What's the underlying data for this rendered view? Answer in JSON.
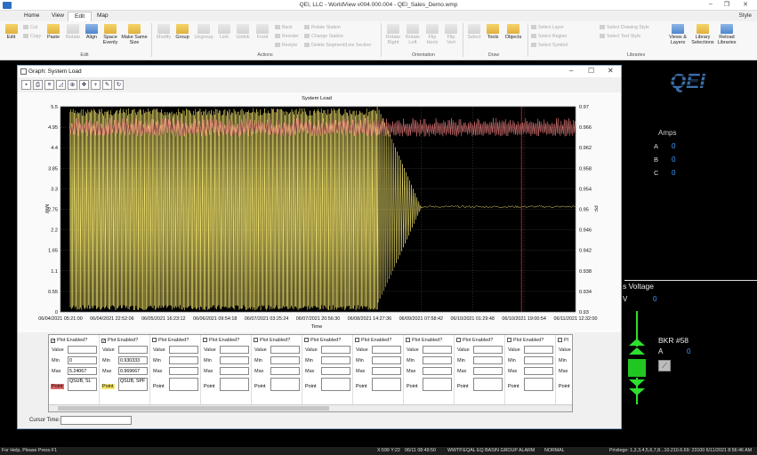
{
  "window": {
    "title": "QEI, LLC - WorldView v004.000.004 - QEI_Sales_Demo.wmp"
  },
  "menu": {
    "tabs": [
      "Home",
      "View",
      "Edit",
      "Map"
    ],
    "active": "Edit",
    "style_label": "Style"
  },
  "ribbon": {
    "edit_label": "Edit",
    "cut": "Cut",
    "copy": "Copy",
    "paste": "Paste",
    "rotate": "Rotate",
    "align": "Align",
    "space_evenly": "Space Evenly",
    "make_same_size": "Make Same Size",
    "modify": "Modify",
    "group": "Group",
    "ungroup": "Ungroup",
    "link": "Link",
    "unlink": "Unlink",
    "front": "Front",
    "back": "Back",
    "reorder": "Reorder",
    "restyle": "Restyle",
    "rotate_station": "Rotate Station",
    "change_station": "Change Station",
    "delete_segment": "Delete Segment/Line Section",
    "rotate_right": "Rotate Right",
    "rotate_left": "Rotate Left",
    "flip_horiz": "Flip Horiz",
    "flip_vert": "Flip Vert",
    "select": "Select",
    "tools": "Tools",
    "objects": "Objects",
    "select_layer": "Select Layer",
    "select_region": "Select Region",
    "select_symbol": "Select Symbol",
    "select_drawing_style": "Select Drawing Style",
    "select_text_style": "Select Text Style",
    "views_layers": "Views & Layers",
    "library_selections": "Library Selections",
    "reload_libraries": "Reload Libraries",
    "groups": {
      "edit": "Edit",
      "actions": "Actions",
      "orientation": "Orientation",
      "draw": "Draw",
      "libraries": "Libraries"
    }
  },
  "canvas": {
    "logo": "QEI",
    "amps_label": "Amps",
    "phases": [
      {
        "name": "A",
        "value": "0"
      },
      {
        "name": "B",
        "value": "0"
      },
      {
        "name": "C",
        "value": "0"
      }
    ],
    "bus_voltage_label": "s Voltage",
    "bus_v_unit": "V",
    "bus_v_value": "0",
    "breaker_label": "BKR  #58",
    "breaker_a_label": "A",
    "breaker_a_value": "0"
  },
  "graph_window": {
    "title": "Graph: System Load",
    "legend": [
      {
        "enabled": true,
        "label": "Plot Enabled?",
        "value": "",
        "min": "0",
        "max": "5.24067",
        "name": "QSUB, SL",
        "point": "Point",
        "color": "#e06666"
      },
      {
        "enabled": true,
        "label": "Plot Enabled?",
        "value": "",
        "min": "0.930333",
        "max": "0.969667",
        "name": "QSUB, SPF",
        "point": "Point",
        "color": "#f5e66e"
      },
      {
        "enabled": false,
        "label": "Plot Enabled?",
        "value": "",
        "min": "",
        "max": "",
        "name": "",
        "point": "Point",
        "color": ""
      },
      {
        "enabled": false,
        "label": "Plot Enabled?",
        "value": "",
        "min": "",
        "max": "",
        "name": "",
        "point": "Point",
        "color": ""
      },
      {
        "enabled": false,
        "label": "Plot Enabled?",
        "value": "",
        "min": "",
        "max": "",
        "name": "",
        "point": "Point",
        "color": ""
      },
      {
        "enabled": false,
        "label": "Plot Enabled?",
        "value": "",
        "min": "",
        "max": "",
        "name": "",
        "point": "Point",
        "color": ""
      },
      {
        "enabled": false,
        "label": "Plot Enabled?",
        "value": "",
        "min": "",
        "max": "",
        "name": "",
        "point": "Point",
        "color": ""
      },
      {
        "enabled": false,
        "label": "Plot Enabled?",
        "value": "",
        "min": "",
        "max": "",
        "name": "",
        "point": "Point",
        "color": ""
      },
      {
        "enabled": false,
        "label": "Plot Enabled?",
        "value": "",
        "min": "",
        "max": "",
        "name": "",
        "point": "Point",
        "color": ""
      },
      {
        "enabled": false,
        "label": "Plot Enabled?",
        "value": "",
        "min": "",
        "max": "",
        "name": "",
        "point": "Point",
        "color": ""
      },
      {
        "enabled": false,
        "label": "Pl",
        "value": "",
        "min": "",
        "max": "",
        "name": "",
        "point": "Point",
        "color": ""
      }
    ],
    "row_labels": {
      "value": "Value",
      "min": "Min",
      "max": "Max"
    },
    "cursor_time_label": "Cursor Time:",
    "cursor_time_value": ""
  },
  "chart_data": {
    "type": "line",
    "title": "System Load",
    "xlabel": "Time",
    "ylabel": "MW",
    "y2label": "PF",
    "x_ticks": [
      "06/04/2021 05:21:00",
      "06/04/2021 22:52:06",
      "06/05/2021 16:23:12",
      "06/06/2021 09:54:18",
      "06/07/2021 03:25:24",
      "06/07/2021 20:56:30",
      "06/08/2021 14:27:36",
      "06/09/2021 07:58:42",
      "06/10/2021 01:29:48",
      "06/10/2021 19:00:54",
      "06/11/2021 12:32:00"
    ],
    "ylim": [
      0,
      5.5
    ],
    "y_ticks": [
      "0",
      "0.55",
      "1.1",
      "1.65",
      "2.2",
      "2.75",
      "3.3",
      "3.85",
      "4.4",
      "4.95",
      "5.5"
    ],
    "y2lim": [
      0.93,
      0.97
    ],
    "y2_ticks": [
      "0.93",
      "0.934",
      "0.938",
      "0.942",
      "0.946",
      "0.95",
      "0.954",
      "0.958",
      "0.962",
      "0.966",
      "0.97"
    ],
    "grid": true,
    "series": [
      {
        "name": "QSUB, SL",
        "color": "#f08080",
        "axis": "left",
        "min": 0,
        "max": 5.24067
      },
      {
        "name": "QSUB, SPF",
        "color": "#f5e66e",
        "axis": "right",
        "min": 0.930333,
        "max": 0.969667
      }
    ],
    "cursor_at_tick_index": 8.95
  },
  "statusbar": {
    "help": "For Help, Please Press F1",
    "coords": "X:599 Y:22",
    "time": "06/11 08:49:50",
    "alarm": "WWTP.EQAL  EQ BASIN GROUP ALARM",
    "state": "NORMAL",
    "privilege": "Privilege: 1,2,3,4,5,6,7,8...10.210.6.69: 23100  6/11/2021 8:56:46 AM"
  }
}
